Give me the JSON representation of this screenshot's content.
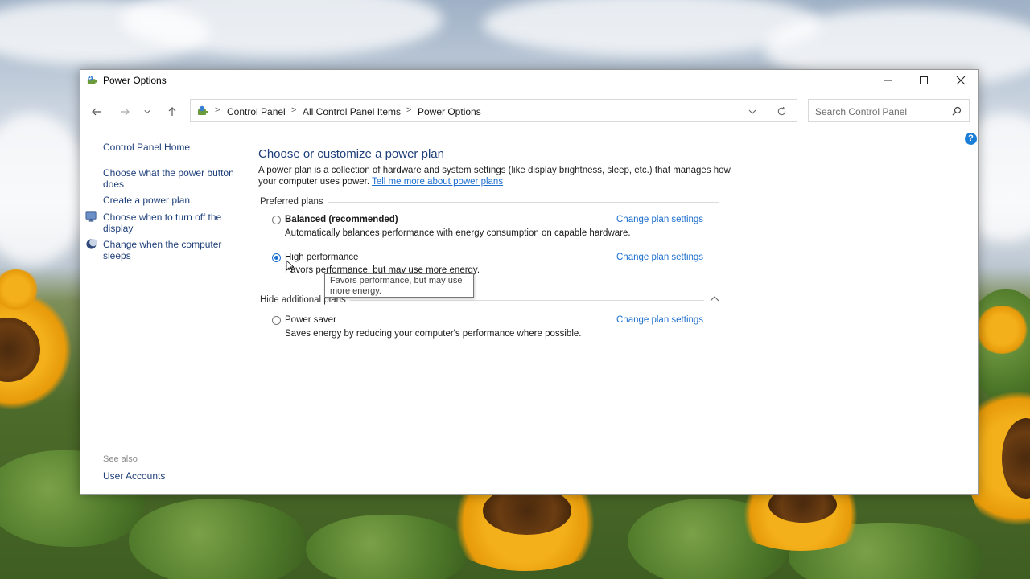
{
  "window": {
    "title": "Power Options",
    "controls": [
      "minimize",
      "maximize",
      "close"
    ]
  },
  "navigation": {
    "breadcrumb": [
      "Control Panel",
      "All Control Panel Items",
      "Power Options"
    ],
    "search_placeholder": "Search Control Panel"
  },
  "sidebar": {
    "home": "Control Panel Home",
    "items": [
      {
        "label": "Choose what the power button does",
        "icon": ""
      },
      {
        "label": "Create a power plan",
        "icon": ""
      },
      {
        "label": "Choose when to turn off the display",
        "icon": "display-icon"
      },
      {
        "label": "Change when the computer sleeps",
        "icon": "moon-icon"
      }
    ],
    "see_also_label": "See also",
    "see_also_items": [
      "User Accounts"
    ]
  },
  "main": {
    "title": "Choose or customize a power plan",
    "description": "A power plan is a collection of hardware and system settings (like display brightness, sleep, etc.) that manages how your computer uses power.",
    "description_link": "Tell me more about power plans",
    "preferred_label": "Preferred plans",
    "additional_label": "Hide additional plans",
    "plans": [
      {
        "name": "Balanced (recommended)",
        "description": "Automatically balances performance with energy consumption on capable hardware.",
        "selected": false,
        "link": "Change plan settings"
      },
      {
        "name": "High performance",
        "description": "Favors performance, but may use more energy.",
        "selected": true,
        "link": "Change plan settings"
      },
      {
        "name": "Power saver",
        "description": "Saves energy by reducing your computer's performance where possible.",
        "selected": false,
        "link": "Change plan settings"
      }
    ],
    "tooltip": "Favors performance, but may use more energy."
  },
  "colors": {
    "link": "#1e6fcf",
    "title": "#1e3f7a",
    "help": "#1c7ed6"
  }
}
